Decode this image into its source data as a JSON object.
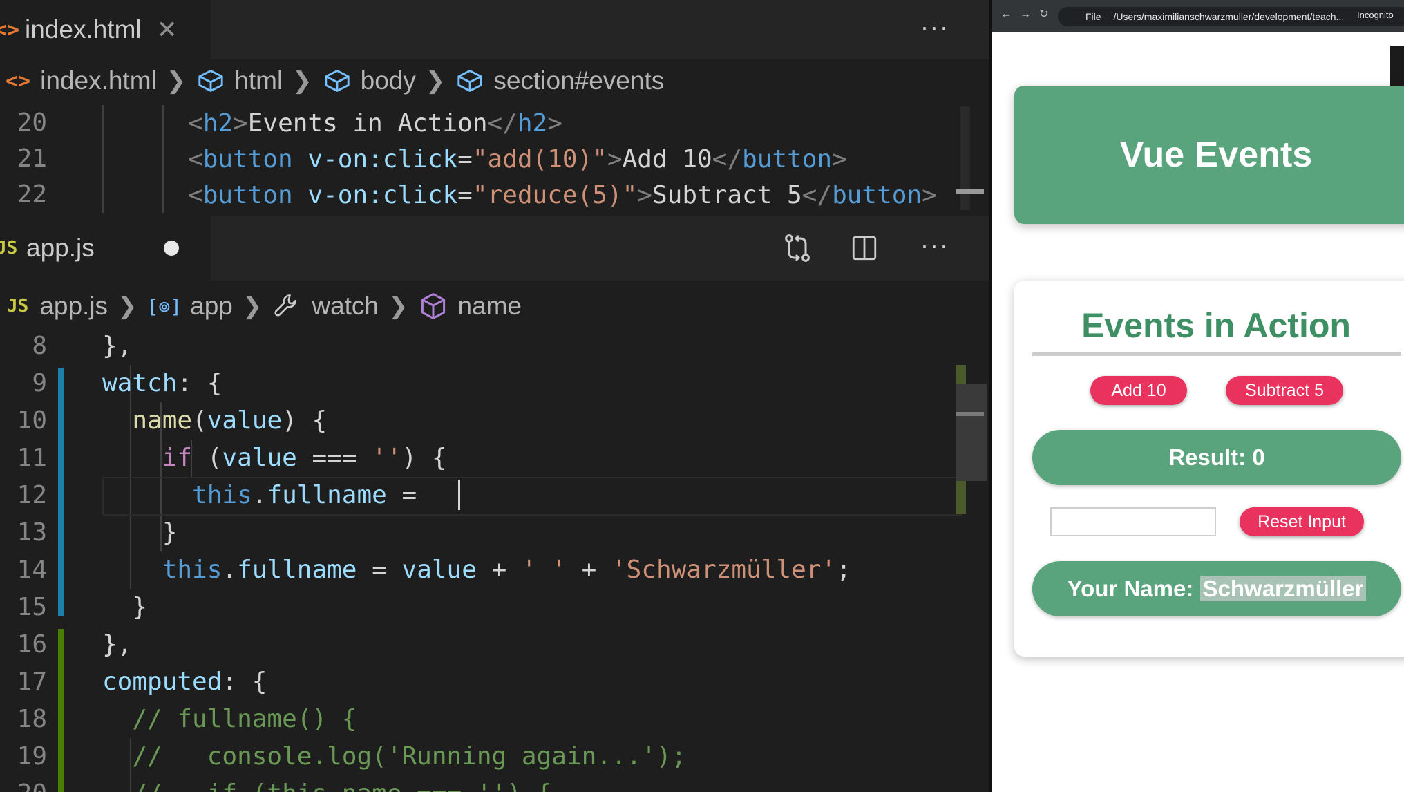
{
  "editor_top": {
    "tab_label": "index.html",
    "breadcrumb": [
      "index.html",
      "html",
      "body",
      "section#events"
    ],
    "lines": [
      {
        "n": "20",
        "parts": [
          [
            "ang",
            "<"
          ],
          [
            "tag",
            "h2"
          ],
          [
            "ang",
            ">"
          ],
          [
            "pl",
            "Events in Action"
          ],
          [
            "ang",
            "</"
          ],
          [
            "tag",
            "h2"
          ],
          [
            "ang",
            ">"
          ]
        ]
      },
      {
        "n": "21",
        "parts": [
          [
            "ang",
            "<"
          ],
          [
            "tag",
            "button"
          ],
          [
            "pl",
            " "
          ],
          [
            "var",
            "v-on:click"
          ],
          [
            "pl",
            "="
          ],
          [
            "str",
            "\"add(10)\""
          ],
          [
            "ang",
            ">"
          ],
          [
            "pl",
            "Add 10"
          ],
          [
            "ang",
            "</"
          ],
          [
            "tag",
            "button"
          ],
          [
            "ang",
            ">"
          ]
        ]
      },
      {
        "n": "22",
        "parts": [
          [
            "ang",
            "<"
          ],
          [
            "tag",
            "button"
          ],
          [
            "pl",
            " "
          ],
          [
            "var",
            "v-on:click"
          ],
          [
            "pl",
            "="
          ],
          [
            "str",
            "\"reduce(5)\""
          ],
          [
            "ang",
            ">"
          ],
          [
            "pl",
            "Subtract 5"
          ],
          [
            "ang",
            "</"
          ],
          [
            "tag",
            "button"
          ],
          [
            "ang",
            ">"
          ]
        ]
      }
    ]
  },
  "editor_bottom": {
    "tab_label": "app.js",
    "tab_icon": "JS",
    "breadcrumb_icon": "JS",
    "breadcrumb": [
      "app.js",
      "app",
      "watch",
      "name"
    ],
    "lines": [
      {
        "n": "8",
        "parts": [
          [
            "pl",
            "},"
          ]
        ]
      },
      {
        "n": "9",
        "parts": [
          [
            "var",
            "watch"
          ],
          [
            "pl",
            ": {"
          ]
        ]
      },
      {
        "n": "10",
        "parts": [
          [
            "pl",
            "  "
          ],
          [
            "fn",
            "name"
          ],
          [
            "pl",
            "("
          ],
          [
            "var",
            "value"
          ],
          [
            "pl",
            ") {"
          ]
        ]
      },
      {
        "n": "11",
        "parts": [
          [
            "pl",
            "    "
          ],
          [
            "kw",
            "if"
          ],
          [
            "pl",
            " ("
          ],
          [
            "var",
            "value"
          ],
          [
            "pl",
            " === "
          ],
          [
            "str",
            "''"
          ],
          [
            "pl",
            ") {"
          ]
        ]
      },
      {
        "n": "12",
        "parts": [
          [
            "pl",
            "      "
          ],
          [
            "th",
            "this"
          ],
          [
            "pl",
            "."
          ],
          [
            "var",
            "fullname"
          ],
          [
            "pl",
            " = "
          ]
        ]
      },
      {
        "n": "13",
        "parts": [
          [
            "pl",
            "    }"
          ]
        ]
      },
      {
        "n": "14",
        "parts": [
          [
            "pl",
            "    "
          ],
          [
            "th",
            "this"
          ],
          [
            "pl",
            "."
          ],
          [
            "var",
            "fullname"
          ],
          [
            "pl",
            " = "
          ],
          [
            "var",
            "value"
          ],
          [
            "pl",
            " + "
          ],
          [
            "str",
            "' '"
          ],
          [
            "pl",
            " + "
          ],
          [
            "str",
            "'Schwarzmüller'"
          ],
          [
            "pl",
            ";"
          ]
        ]
      },
      {
        "n": "15",
        "parts": [
          [
            "pl",
            "  }"
          ]
        ]
      },
      {
        "n": "16",
        "parts": [
          [
            "pl",
            "},"
          ]
        ]
      },
      {
        "n": "17",
        "parts": [
          [
            "var",
            "computed"
          ],
          [
            "pl",
            ": {"
          ]
        ]
      },
      {
        "n": "18",
        "parts": [
          [
            "pl",
            "  "
          ],
          [
            "cm",
            "// fullname() {"
          ]
        ]
      },
      {
        "n": "19",
        "parts": [
          [
            "pl",
            "  "
          ],
          [
            "cm",
            "//   console.log('Running again...');"
          ]
        ]
      },
      {
        "n": "20",
        "parts": [
          [
            "pl",
            "  "
          ],
          [
            "cm",
            "//   if (this.name === '') {"
          ]
        ]
      }
    ]
  },
  "more_label": "···",
  "browser": {
    "url_prefix": "File",
    "url": "/Users/maximilianschwarzmuller/development/teach...",
    "incognito": "Incognito",
    "header_title": "Vue Events",
    "section_title": "Events in Action",
    "add_button": "Add 10",
    "subtract_button": "Subtract 5",
    "result_text": "Result: 0",
    "name_input_value": "",
    "reset_button": "Reset Input",
    "name_label": "Your Name: ",
    "name_value": "Schwarzmüller"
  },
  "colors": {
    "editor_bg": "#1e1e1e",
    "vue_green": "#59a47d",
    "vue_pink": "#e9335e",
    "section_title": "#3e8f63"
  }
}
